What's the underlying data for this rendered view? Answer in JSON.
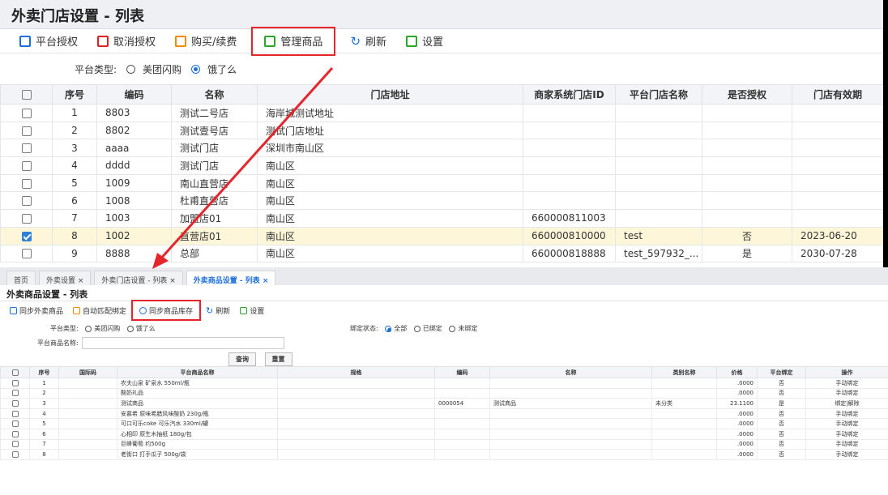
{
  "top": {
    "title": "外卖门店设置 - 列表",
    "toolbar": [
      {
        "label": "平台授权",
        "color": "#1e6fd9"
      },
      {
        "label": "取消授权",
        "color": "#e02020"
      },
      {
        "label": "购买/续费",
        "color": "#f08a00"
      },
      {
        "label": "管理商品",
        "color": "#2aa52a"
      },
      {
        "label": "刷新",
        "color": "#1e6fd9"
      },
      {
        "label": "设置",
        "color": "#2aa52a"
      }
    ],
    "filter": {
      "label": "平台类型:",
      "opt1": "美团闪购",
      "opt2": "饿了么"
    },
    "headers": [
      "序号",
      "编码",
      "名称",
      "门店地址",
      "商家系统门店ID",
      "平台门店名称",
      "是否授权",
      "门店有效期"
    ],
    "rows": [
      {
        "no": "1",
        "code": "8803",
        "name": "测试二号店",
        "addr": "海岸城测试地址",
        "sid": "",
        "pname": "",
        "auth": "",
        "exp": "",
        "checked": false
      },
      {
        "no": "2",
        "code": "8802",
        "name": "测试壹号店",
        "addr": "测试门店地址",
        "sid": "",
        "pname": "",
        "auth": "",
        "exp": "",
        "checked": false
      },
      {
        "no": "3",
        "code": "aaaa",
        "name": "测试门店",
        "addr": "深圳市南山区",
        "sid": "",
        "pname": "",
        "auth": "",
        "exp": "",
        "checked": false
      },
      {
        "no": "4",
        "code": "dddd",
        "name": "测试门店",
        "addr": "南山区",
        "sid": "",
        "pname": "",
        "auth": "",
        "exp": "",
        "checked": false
      },
      {
        "no": "5",
        "code": "1009",
        "name": "南山直营店",
        "addr": "南山区",
        "sid": "",
        "pname": "",
        "auth": "",
        "exp": "",
        "checked": false
      },
      {
        "no": "6",
        "code": "1008",
        "name": "杜甫直营店",
        "addr": "南山区",
        "sid": "",
        "pname": "",
        "auth": "",
        "exp": "",
        "checked": false
      },
      {
        "no": "7",
        "code": "1003",
        "name": "加盟店01",
        "addr": "南山区",
        "sid": "660000811003",
        "pname": "",
        "auth": "",
        "exp": "",
        "checked": false
      },
      {
        "no": "8",
        "code": "1002",
        "name": "直营店01",
        "addr": "南山区",
        "sid": "660000810000",
        "pname": "test",
        "auth": "否",
        "exp": "2023-06-20",
        "checked": true
      },
      {
        "no": "9",
        "code": "8888",
        "name": "总部",
        "addr": "南山区",
        "sid": "660000818888",
        "pname": "test_597932_...",
        "auth": "是",
        "exp": "2030-07-28",
        "checked": false
      }
    ]
  },
  "bottom": {
    "tabs": [
      "首页",
      "外卖设置 ×",
      "外卖门店设置 - 列表 ×",
      "外卖商品设置 - 列表 ×"
    ],
    "title": "外卖商品设置 - 列表",
    "toolbar": [
      {
        "label": "同步外卖商品",
        "color": "#1e6fd9"
      },
      {
        "label": "自动匹配绑定",
        "color": "#f08a00"
      },
      {
        "label": "同步商品库存",
        "color": "#1e6fd9"
      },
      {
        "label": "刷新",
        "color": "#1e6fd9"
      },
      {
        "label": "设置",
        "color": "#2aa52a"
      }
    ],
    "filter": {
      "platform_label": "平台类型:",
      "opt1": "美团闪购",
      "opt2": "饿了么",
      "bind_label": "绑定状态:",
      "bind_all": "全部",
      "bind_yes": "已绑定",
      "bind_no": "未绑定",
      "name_label": "平台商品名称:",
      "name_value": "",
      "query": "查询",
      "reset": "重置"
    },
    "headers": [
      "序号",
      "国际码",
      "平台商品名称",
      "规格",
      "编码",
      "名称",
      "类别名称",
      "价格",
      "平台绑定",
      "操作"
    ],
    "rows": [
      {
        "no": "1",
        "intl": "",
        "pname": "农夫山泉 矿泉水 550ml/瓶",
        "spec": "",
        "code": "",
        "name": "",
        "cat": "",
        "price": ".0000",
        "bind": "否",
        "op": "手动绑定"
      },
      {
        "no": "2",
        "intl": "",
        "pname": "酸奶礼品",
        "spec": "",
        "code": "",
        "name": "",
        "cat": "",
        "price": ".0000",
        "bind": "否",
        "op": "手动绑定"
      },
      {
        "no": "3",
        "intl": "",
        "pname": "测试商品",
        "spec": "",
        "code": "0000054",
        "name": "测试商品",
        "cat": "未分类",
        "price": "23.1100",
        "bind": "是",
        "op": "绑定|解除"
      },
      {
        "no": "4",
        "intl": "",
        "pname": "安慕希 原味希腊风味酸奶 230g/瓶",
        "spec": "",
        "code": "",
        "name": "",
        "cat": "",
        "price": ".0000",
        "bind": "否",
        "op": "手动绑定"
      },
      {
        "no": "5",
        "intl": "",
        "pname": "可口可乐coke 可乐汽水 330ml/罐",
        "spec": "",
        "code": "",
        "name": "",
        "cat": "",
        "price": ".0000",
        "bind": "否",
        "op": "手动绑定"
      },
      {
        "no": "6",
        "intl": "",
        "pname": "心相印 原生木抽纸 180g/包",
        "spec": "",
        "code": "",
        "name": "",
        "cat": "",
        "price": ".0000",
        "bind": "否",
        "op": "手动绑定"
      },
      {
        "no": "7",
        "intl": "",
        "pname": "巨峰葡萄 约500g",
        "spec": "",
        "code": "",
        "name": "",
        "cat": "",
        "price": ".0000",
        "bind": "否",
        "op": "手动绑定"
      },
      {
        "no": "8",
        "intl": "",
        "pname": "老街口 打手瓜子 500g/袋",
        "spec": "",
        "code": "",
        "name": "",
        "cat": "",
        "price": ".0000",
        "bind": "否",
        "op": "手动绑定"
      }
    ]
  },
  "annotation_color": "#e5242b"
}
